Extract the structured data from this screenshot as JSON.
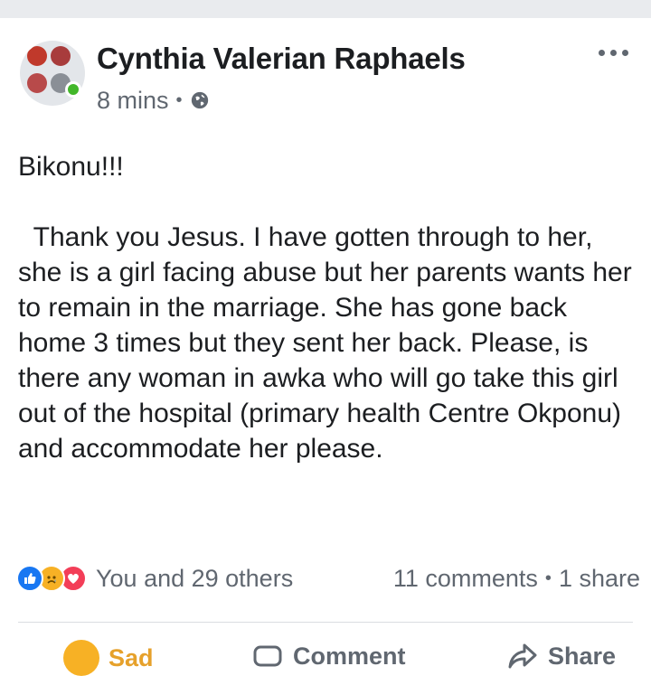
{
  "post": {
    "author": "Cynthia Valerian Raphaels",
    "time": "8 mins",
    "privacy_icon": "globe-icon",
    "text": "Bikonu!!!\n\n  Thank you Jesus. I have gotten through to her, she is a girl facing abuse but her parents wants her to remain in the marriage. She has gone back home 3 times but they sent her back. Please, is there any woman in awka who will go take this girl out of the hospital (primary health Centre Okponu) and accommodate her please."
  },
  "reactions": {
    "summary": "You and 29 others",
    "comments": "11 comments",
    "shares": "1 share",
    "icons": [
      "like-icon",
      "sad-icon",
      "love-icon"
    ]
  },
  "actions": {
    "sad_label": "Sad",
    "comment_label": "Comment",
    "share_label": "Share"
  },
  "colors": {
    "like": "#1877f2",
    "love": "#f33e58",
    "sad": "#f7b125",
    "online": "#42b72a",
    "text_secondary": "#606770"
  }
}
